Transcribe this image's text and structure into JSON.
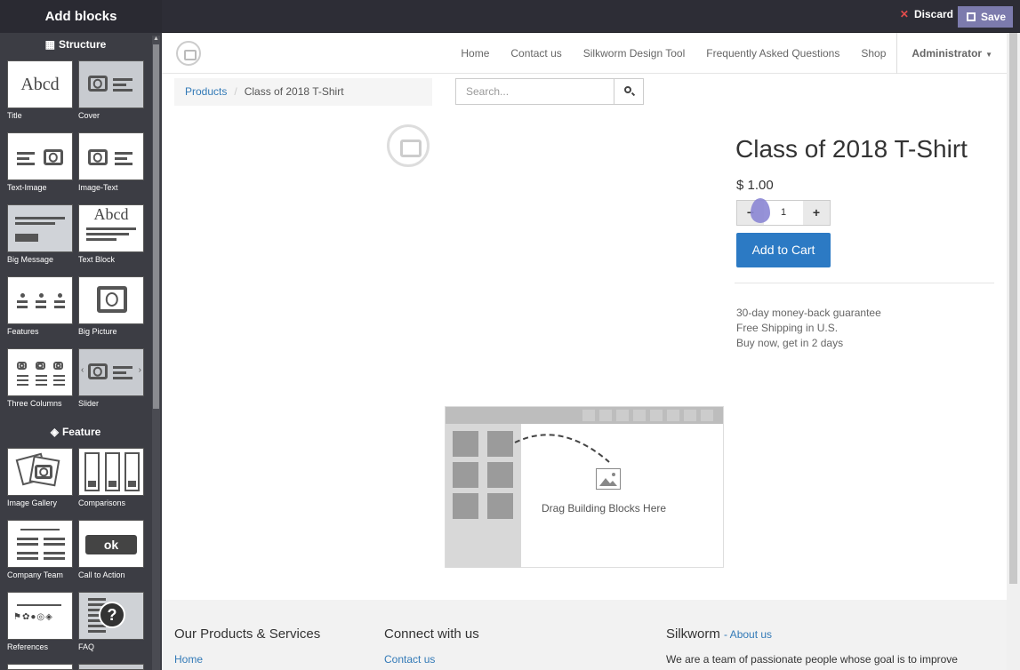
{
  "topbar": {
    "title": "Add blocks",
    "discard_label": "Discard",
    "save_label": "Save"
  },
  "sidebar": {
    "structure_heading": "Structure",
    "feature_heading": "Feature",
    "blocks": [
      {
        "label": "Title",
        "thumb_text": "Abcd"
      },
      {
        "label": "Cover"
      },
      {
        "label": "Text-Image"
      },
      {
        "label": "Image-Text"
      },
      {
        "label": "Big Message"
      },
      {
        "label": "Text Block",
        "thumb_text": "Abcd"
      },
      {
        "label": "Features"
      },
      {
        "label": "Big Picture"
      },
      {
        "label": "Three Columns"
      },
      {
        "label": "Slider"
      },
      {
        "label": "Image Gallery"
      },
      {
        "label": "Comparisons"
      },
      {
        "label": "Company Team"
      },
      {
        "label": "Call to Action",
        "thumb_text": "ok"
      },
      {
        "label": "References"
      },
      {
        "label": "FAQ",
        "thumb_text": "?"
      }
    ]
  },
  "nav": {
    "items": [
      "Home",
      "Contact us",
      "Silkworm Design Tool",
      "Frequently Asked Questions",
      "Shop"
    ],
    "user": "Administrator"
  },
  "breadcrumb": {
    "parent": "Products",
    "current": "Class of 2018 T-Shirt"
  },
  "search": {
    "placeholder": "Search..."
  },
  "product": {
    "name": "Class of 2018 T-Shirt",
    "price": "$ 1.00",
    "quantity": "1",
    "add_to_cart": "Add to Cart",
    "terms": [
      "30-day money-back guarantee",
      "Free Shipping in U.S.",
      "Buy now, get in 2 days"
    ]
  },
  "dropzone": {
    "text": "Drag Building Blocks Here"
  },
  "footer": {
    "col1_title": "Our Products & Services",
    "col1_link": "Home",
    "col2_title": "Connect with us",
    "col2_link": "Contact us",
    "col3_title": "Silkworm",
    "col3_about": "- About us",
    "col3_text": "We are a team of passionate people whose goal is to improve"
  },
  "colors": {
    "topbar_bg": "#2d2d36",
    "sidebar_bg": "#3c3d44",
    "save_bg": "#7c7bad",
    "discard_icon": "#e34c4c",
    "primary_button": "#2c7ac4",
    "link": "#337ab7"
  }
}
